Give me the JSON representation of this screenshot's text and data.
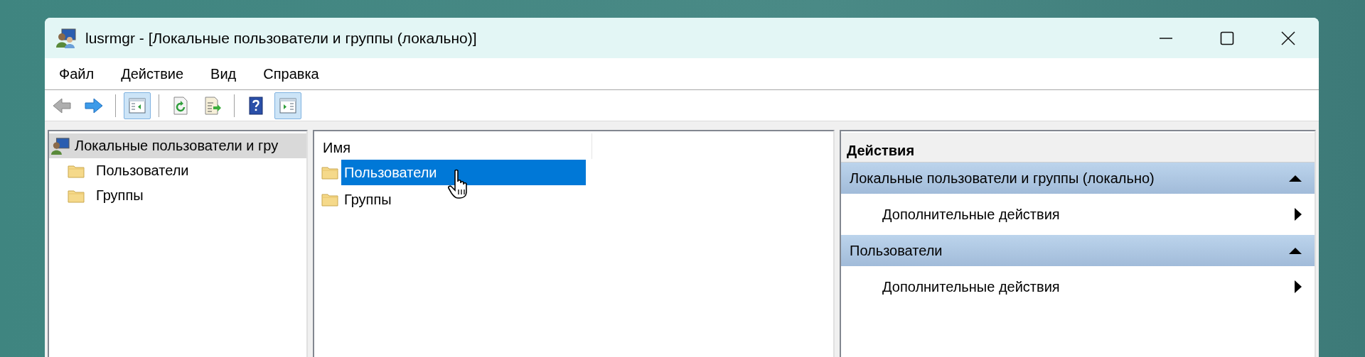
{
  "window": {
    "title": "lusrmgr - [Локальные пользователи и группы (локально)]"
  },
  "menu": [
    "Файл",
    "Действие",
    "Вид",
    "Справка"
  ],
  "toolbar": [
    {
      "kind": "back",
      "pressed": false,
      "disabled": true
    },
    {
      "kind": "forward",
      "pressed": false,
      "disabled": false
    },
    {
      "kind": "tree",
      "pressed": true,
      "disabled": false
    },
    {
      "kind": "refresh",
      "pressed": false,
      "disabled": false
    },
    {
      "kind": "export",
      "pressed": false,
      "disabled": false
    },
    {
      "kind": "help",
      "pressed": false,
      "disabled": false
    },
    {
      "kind": "actionpane",
      "pressed": true,
      "disabled": false
    }
  ],
  "tree": [
    {
      "label": "Локальные пользователи и гру",
      "selected": true,
      "children": [
        {
          "label": "Пользователи",
          "selected": false
        },
        {
          "label": "Группы",
          "selected": false
        }
      ]
    }
  ],
  "list": {
    "columns": [
      "Имя"
    ],
    "rows": [
      {
        "name": "Пользователи",
        "selected": true
      },
      {
        "name": "Группы",
        "selected": false
      }
    ]
  },
  "actions": {
    "title": "Действия",
    "sections": [
      {
        "title": "Локальные пользователи и группы (локально)",
        "expanded": true,
        "items": [
          "Дополнительные действия"
        ]
      },
      {
        "title": "Пользователи",
        "expanded": true,
        "items": [
          "Дополнительные действия"
        ]
      }
    ]
  }
}
